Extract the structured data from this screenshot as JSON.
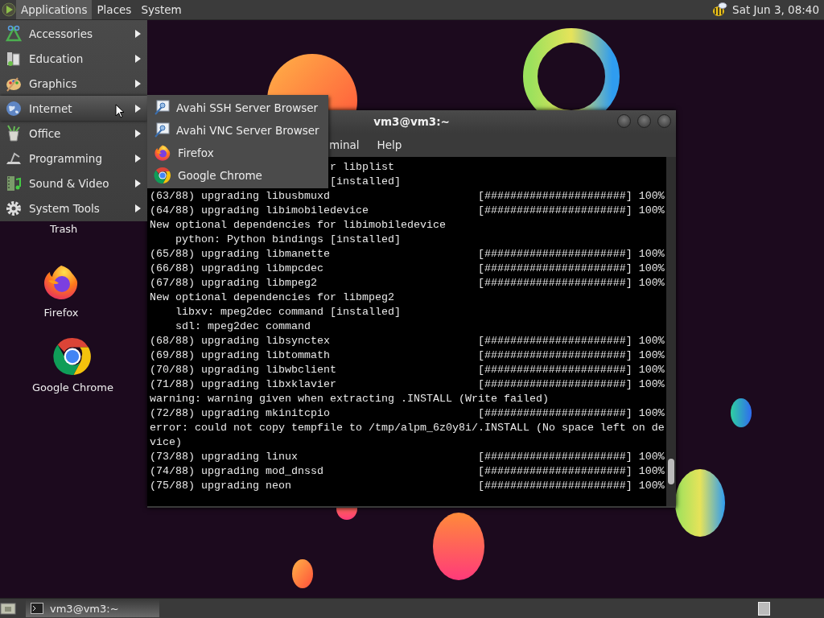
{
  "top_panel": {
    "menus": [
      {
        "label": "Applications",
        "selected": true
      },
      {
        "label": "Places",
        "selected": false
      },
      {
        "label": "System",
        "selected": false
      }
    ],
    "clock": "Sat Jun 3, 08:40"
  },
  "applications_menu": {
    "items": [
      {
        "label": "Accessories",
        "selected": false
      },
      {
        "label": "Education",
        "selected": false
      },
      {
        "label": "Graphics",
        "selected": false
      },
      {
        "label": "Internet",
        "selected": true
      },
      {
        "label": "Office",
        "selected": false
      },
      {
        "label": "Programming",
        "selected": false
      },
      {
        "label": "Sound & Video",
        "selected": false
      },
      {
        "label": "System Tools",
        "selected": false
      }
    ]
  },
  "internet_submenu": {
    "items": [
      {
        "label": "Avahi SSH Server Browser",
        "kind": "avahi"
      },
      {
        "label": "Avahi VNC Server Browser",
        "kind": "avahi"
      },
      {
        "label": "Firefox",
        "kind": "firefox"
      },
      {
        "label": "Google Chrome",
        "kind": "chrome"
      }
    ]
  },
  "desktop_icons": [
    {
      "label": "Trash",
      "kind": "trash"
    },
    {
      "label": "Firefox",
      "kind": "firefox"
    },
    {
      "label": "Google Chrome",
      "kind": "chrome"
    }
  ],
  "terminal": {
    "title": "vm3@vm3:~",
    "menus": [
      "minal",
      "Help"
    ],
    "lines": [
      {
        "kind": "partial",
        "text": "r libplist"
      },
      {
        "kind": "partial",
        "text": "[installed]"
      },
      {
        "kind": "progress",
        "text": "(63/88) upgrading libusbmuxd",
        "progress": "[######################] 100%"
      },
      {
        "kind": "progress",
        "text": "(64/88) upgrading libimobiledevice",
        "progress": "[######################] 100%"
      },
      {
        "kind": "plain",
        "text": "New optional dependencies for libimobiledevice"
      },
      {
        "kind": "plain",
        "text": "    python: Python bindings [installed]"
      },
      {
        "kind": "progress",
        "text": "(65/88) upgrading libmanette",
        "progress": "[######################] 100%"
      },
      {
        "kind": "progress",
        "text": "(66/88) upgrading libmpcdec",
        "progress": "[######################] 100%"
      },
      {
        "kind": "progress",
        "text": "(67/88) upgrading libmpeg2",
        "progress": "[######################] 100%"
      },
      {
        "kind": "plain",
        "text": "New optional dependencies for libmpeg2"
      },
      {
        "kind": "plain",
        "text": "    libxv: mpeg2dec command [installed]"
      },
      {
        "kind": "plain",
        "text": "    sdl: mpeg2dec command"
      },
      {
        "kind": "progress",
        "text": "(68/88) upgrading libsynctex",
        "progress": "[######################] 100%"
      },
      {
        "kind": "progress",
        "text": "(69/88) upgrading libtommath",
        "progress": "[######################] 100%"
      },
      {
        "kind": "progress",
        "text": "(70/88) upgrading libwbclient",
        "progress": "[######################] 100%"
      },
      {
        "kind": "progress",
        "text": "(71/88) upgrading libxklavier",
        "progress": "[######################] 100%"
      },
      {
        "kind": "plain",
        "text": "warning: warning given when extracting .INSTALL (Write failed)"
      },
      {
        "kind": "progress",
        "text": "(72/88) upgrading mkinitcpio",
        "progress": "[######################] 100%"
      },
      {
        "kind": "plain",
        "text": "error: could not copy tempfile to /tmp/alpm_6z0y8i/.INSTALL (No space left on device)"
      },
      {
        "kind": "progress",
        "text": "(73/88) upgrading linux",
        "progress": "[######################] 100%"
      },
      {
        "kind": "progress",
        "text": "(74/88) upgrading mod_dnssd",
        "progress": "[######################] 100%"
      },
      {
        "kind": "progress",
        "text": "(75/88) upgrading neon",
        "progress": "[######################] 100%"
      }
    ]
  },
  "taskbar": {
    "tasks": [
      {
        "label": "vm3@vm3:~",
        "selected": true
      }
    ]
  }
}
